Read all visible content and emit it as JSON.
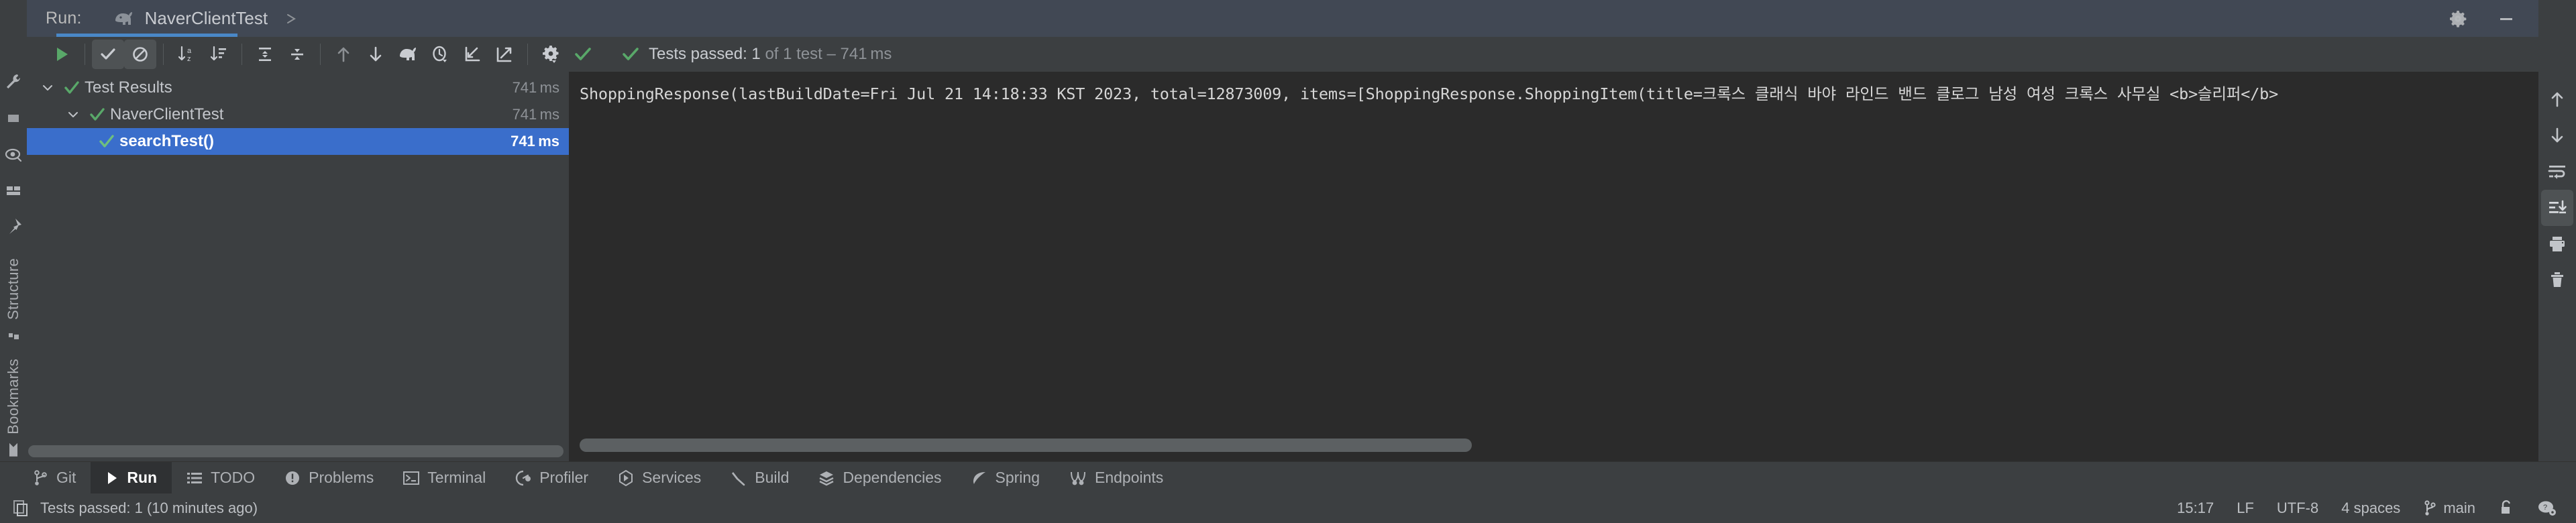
{
  "header": {
    "run_label": "Run:",
    "tab_name": "NaverClientTest",
    "tab_icon": "gradle-elephant-icon",
    "close_icon": "close-icon",
    "settings_icon": "gear-icon",
    "minimize_icon": "minimize-icon"
  },
  "toolbar": {
    "rerun_label": "Rerun",
    "show_passed_label": "Show Passed",
    "show_ignored_label": "Show Ignored",
    "sort_alpha_label": "Sort Alphabetically",
    "sort_duration_label": "Sort by Duration",
    "expand_all_label": "Expand All",
    "collapse_all_label": "Collapse All",
    "prev_label": "Previous Failed Test",
    "next_label": "Next Failed Test",
    "gradle_label": "Run with Gradle",
    "history_label": "Test History",
    "import_label": "Import Tests",
    "export_label": "Export Test Results",
    "settings_label": "Settings",
    "check_label": "Tests Passed"
  },
  "status": {
    "icon": "check-icon",
    "prefix": "Tests passed: ",
    "count": "1",
    "suffix": " of 1 test – 741 ms"
  },
  "left_strip": {
    "icons": [
      "wrench-icon",
      "window-icon",
      "eye-icon",
      "layout-icon",
      "pin-icon"
    ],
    "labels": [
      {
        "text": "Structure",
        "icon": "structure-icon"
      },
      {
        "text": "Bookmarks",
        "icon": "bookmark-icon"
      }
    ]
  },
  "tree": {
    "rows": [
      {
        "name": "Test Results",
        "duration": "741 ms",
        "indent": 1,
        "expanded": true,
        "has_arrow": true,
        "selected": false
      },
      {
        "name": "NaverClientTest",
        "duration": "741 ms",
        "indent": 2,
        "expanded": true,
        "has_arrow": true,
        "selected": false
      },
      {
        "name": "searchTest()",
        "duration": "741 ms",
        "indent": 3,
        "expanded": false,
        "has_arrow": false,
        "selected": true
      }
    ]
  },
  "console": {
    "line": "ShoppingResponse(lastBuildDate=Fri Jul 21 14:18:33 KST 2023, total=12873009, items=[ShoppingResponse.ShoppingItem(title=크록스 클래식 바야 라인드 밴드 클로그 남성 여성 크록스 사무실 <b>슬리퍼</b>"
  },
  "right_strip": {
    "buttons": [
      {
        "name": "scroll-up-icon",
        "label": "Up",
        "active": false
      },
      {
        "name": "scroll-down-icon",
        "label": "Down",
        "active": false
      },
      {
        "name": "soft-wrap-icon",
        "label": "Soft-Wrap",
        "active": false
      },
      {
        "name": "scroll-to-end-icon",
        "label": "Scroll to End",
        "active": true
      },
      {
        "name": "print-icon",
        "label": "Print",
        "active": false
      },
      {
        "name": "trash-icon",
        "label": "Clear All",
        "active": false
      }
    ]
  },
  "tool_tabs": [
    {
      "label": "Git",
      "icon": "branch-icon",
      "active": false
    },
    {
      "label": "Run",
      "icon": "play-icon",
      "active": true
    },
    {
      "label": "TODO",
      "icon": "list-icon",
      "active": false
    },
    {
      "label": "Problems",
      "icon": "warning-icon",
      "active": false
    },
    {
      "label": "Terminal",
      "icon": "terminal-icon",
      "active": false
    },
    {
      "label": "Profiler",
      "icon": "profiler-icon",
      "active": false
    },
    {
      "label": "Services",
      "icon": "services-icon",
      "active": false
    },
    {
      "label": "Build",
      "icon": "hammer-icon",
      "active": false
    },
    {
      "label": "Dependencies",
      "icon": "layers-icon",
      "active": false
    },
    {
      "label": "Spring",
      "icon": "leaf-icon",
      "active": false
    },
    {
      "label": "Endpoints",
      "icon": "endpoints-icon",
      "active": false
    }
  ],
  "statusbar": {
    "icon": "copy-icon",
    "message": "Tests passed: 1 (10 minutes ago)",
    "time": "15:17",
    "line_separator": "LF",
    "encoding": "UTF-8",
    "indent": "4 spaces",
    "branch": "main",
    "branch_icon": "branch-icon",
    "lock_icon": "unlock-icon",
    "assistant_icon": "ai-assistant-icon"
  },
  "colors": {
    "accent_blue": "#3a6ecb",
    "tab_underline": "#4a88c7",
    "pass_green": "#59a869",
    "panel_bg": "#3c3f41",
    "console_bg": "#2b2b2b",
    "header_bg": "#414854"
  }
}
